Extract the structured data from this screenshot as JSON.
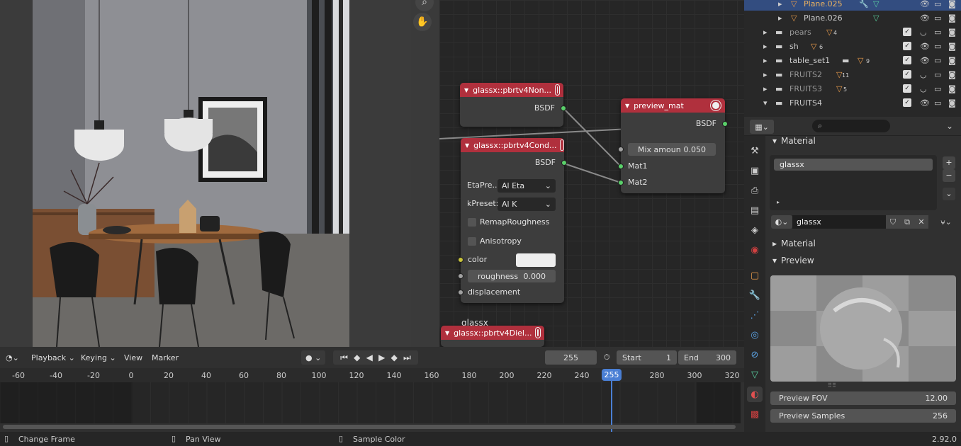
{
  "viewport": {
    "tools": [
      "zoom-icon",
      "hand-icon"
    ]
  },
  "nodes": {
    "node_nonconductor": {
      "title": "glassx::pbrtv4Non...",
      "output": "BSDF"
    },
    "node_conductor": {
      "title": "glassx::pbrtv4Cond...",
      "output": "BSDF",
      "eta_label": "EtaPre...",
      "eta_value": "Al Eta",
      "k_label": "kPreset:",
      "k_value": "Al K",
      "remap_label": "RemapRoughness",
      "aniso_label": "Anisotropy",
      "color_label": "color",
      "roughness_label": "roughness",
      "roughness_value": "0.000",
      "displacement_label": "displacement"
    },
    "node_preview": {
      "title": "preview_mat",
      "output": "BSDF",
      "mix_label": "Mix amoun",
      "mix_value": "0.050",
      "in1": "Mat1",
      "in2": "Mat2"
    },
    "frame_label": "glassx",
    "node_dielectric": {
      "title": "glassx::pbrtv4Diel..."
    }
  },
  "outliner": {
    "items": [
      {
        "name": "Plane.025",
        "badge": ""
      },
      {
        "name": "Plane.026",
        "badge": ""
      },
      {
        "name": "pears",
        "badge": "4"
      },
      {
        "name": "sh",
        "badge": "6"
      },
      {
        "name": "table_set1",
        "badge": "9"
      },
      {
        "name": "FRUITS2",
        "badge": "11"
      },
      {
        "name": "FRUITS3",
        "badge": "5"
      },
      {
        "name": "FRUITS4",
        "badge": ""
      }
    ]
  },
  "properties": {
    "section_material": "Material",
    "slot_name": "glassx",
    "material_name": "glassx",
    "section_material2": "Material",
    "section_preview": "Preview",
    "preview_fov_label": "Preview FOV",
    "preview_fov_value": "12.00",
    "preview_samples_label": "Preview Samples",
    "preview_samples_value": "256"
  },
  "timeline": {
    "playback": "Playback",
    "keying": "Keying",
    "view": "View",
    "marker": "Marker",
    "current_frame": "255",
    "start_label": "Start",
    "start_value": "1",
    "end_label": "End",
    "end_value": "300",
    "ticks": [
      "-60",
      "-40",
      "-20",
      "0",
      "20",
      "40",
      "60",
      "80",
      "100",
      "120",
      "140",
      "160",
      "180",
      "200",
      "220",
      "240",
      "255",
      "280",
      "300",
      "320"
    ]
  },
  "status": {
    "left": "Change Frame",
    "middle": "Pan View",
    "right": "Sample Color",
    "version": "2.92.0"
  }
}
